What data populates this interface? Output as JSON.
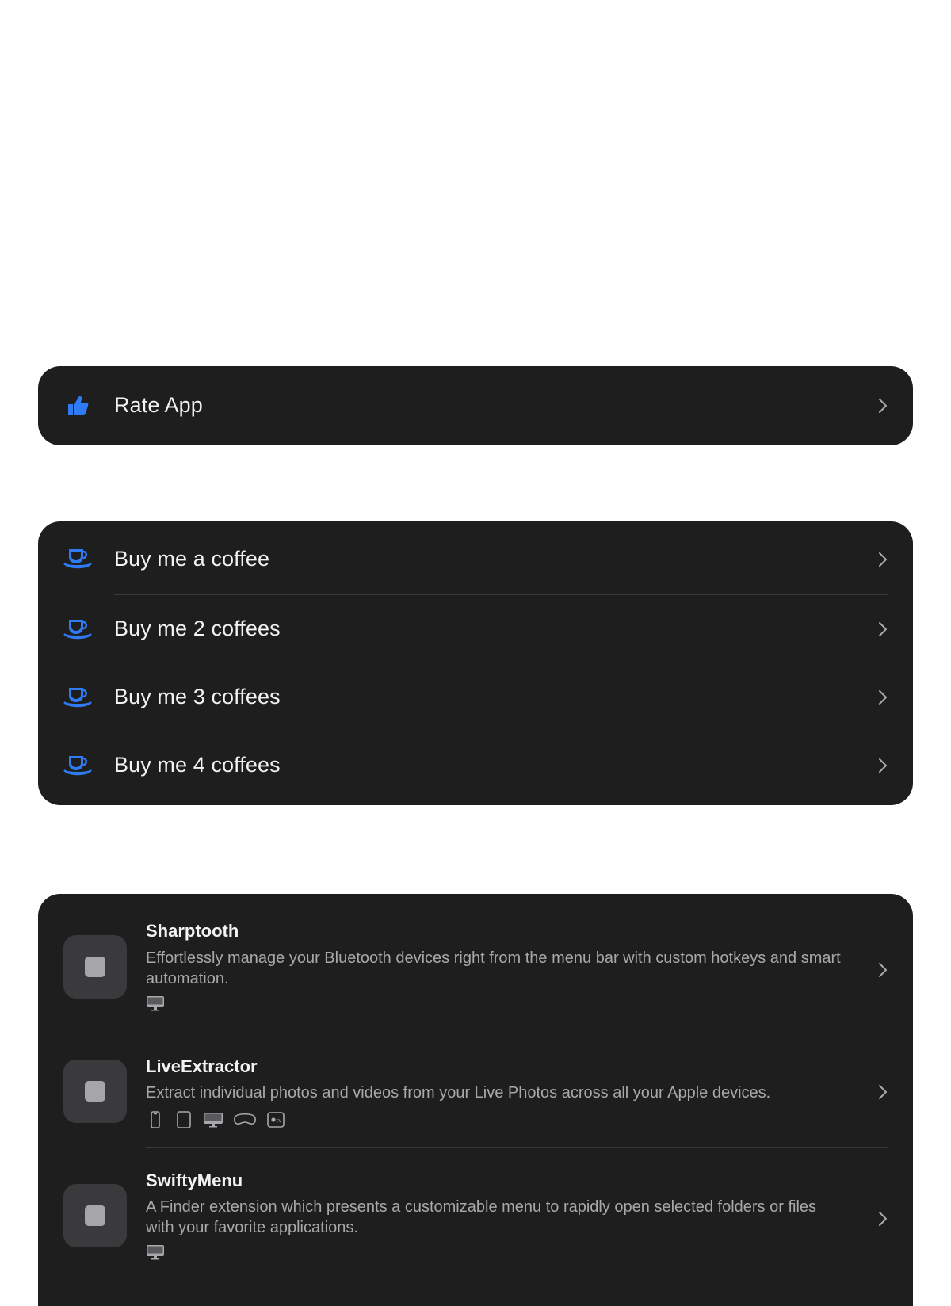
{
  "colors": {
    "card_bg": "#1e1e1f",
    "accent": "#2f7bf5",
    "chevron": "#a8a8ab",
    "text_primary": "#f2f2f2",
    "text_secondary": "#a8a8ab"
  },
  "rate": {
    "label": "Rate App",
    "icon": "thumbs-up-icon"
  },
  "tips": [
    {
      "label": "Buy me a coffee",
      "icon": "coffee-cup-icon"
    },
    {
      "label": "Buy me 2 coffees",
      "icon": "coffee-cup-icon"
    },
    {
      "label": "Buy me 3 coffees",
      "icon": "coffee-cup-icon"
    },
    {
      "label": "Buy me 4 coffees",
      "icon": "coffee-cup-icon"
    }
  ],
  "apps": [
    {
      "name": "Sharptooth",
      "description": "Effortlessly manage your Bluetooth devices right from the menu bar with custom hotkeys and smart automation.",
      "platforms": [
        "mac-icon"
      ]
    },
    {
      "name": "LiveExtractor",
      "description": "Extract individual photos and videos from your Live Photos across all your Apple devices.",
      "platforms": [
        "iphone-icon",
        "ipad-icon",
        "mac-icon",
        "vision-pro-icon",
        "apple-tv-icon"
      ]
    },
    {
      "name": "SwiftyMenu",
      "description": "A Finder extension which presents a customizable menu to rapidly open selected folders or files with your favorite applications.",
      "platforms": [
        "mac-icon"
      ]
    }
  ]
}
